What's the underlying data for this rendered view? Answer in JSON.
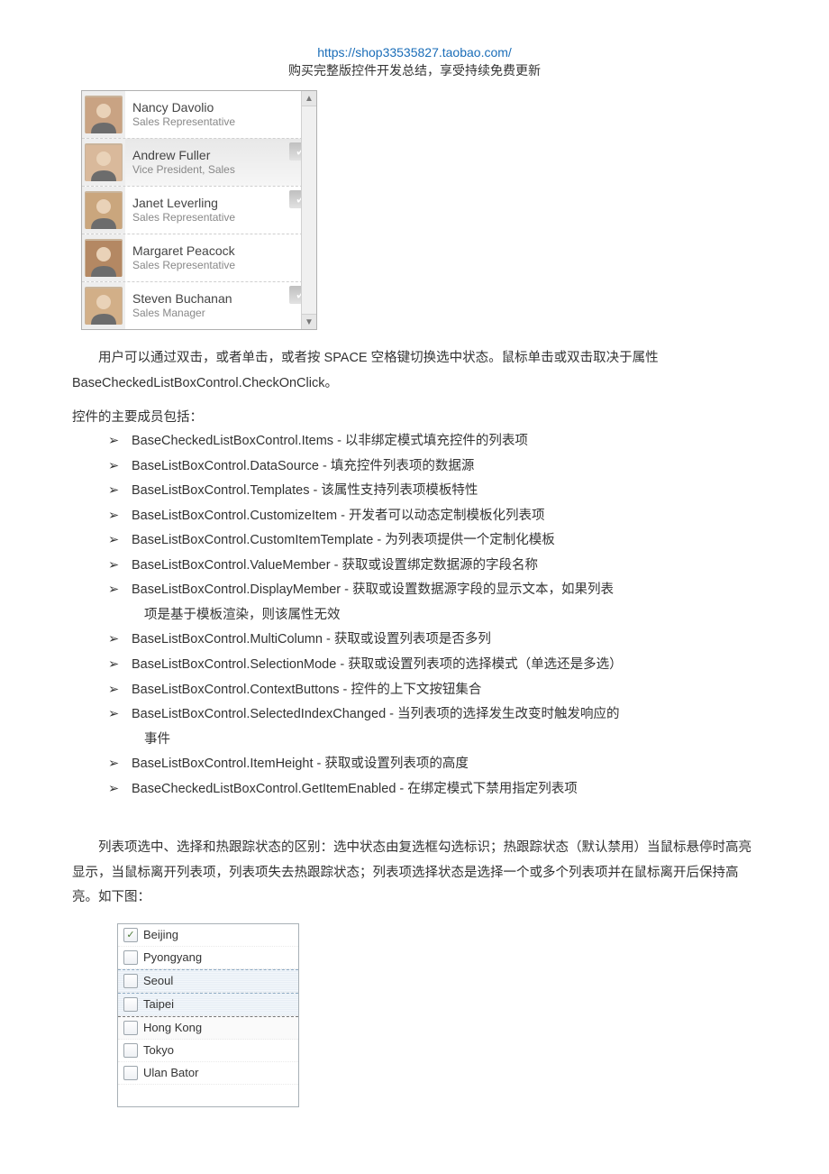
{
  "header": {
    "link": "https://shop33535827.taobao.com/",
    "subtitle": "购买完整版控件开发总结，享受持续免费更新"
  },
  "employees": [
    {
      "name": "Nancy Davolio",
      "title": "Sales Representative",
      "checked": false,
      "selected": false,
      "avatar_bg": "#c9a383"
    },
    {
      "name": "Andrew Fuller",
      "title": "Vice President, Sales",
      "checked": true,
      "selected": true,
      "avatar_bg": "#d9b99b"
    },
    {
      "name": "Janet Leverling",
      "title": "Sales Representative",
      "checked": true,
      "selected": false,
      "avatar_bg": "#caa67d"
    },
    {
      "name": "Margaret Peacock",
      "title": "Sales Representative",
      "checked": false,
      "selected": false,
      "avatar_bg": "#b48863"
    },
    {
      "name": "Steven Buchanan",
      "title": "Sales Manager",
      "checked": true,
      "selected": false,
      "avatar_bg": "#d2af88"
    }
  ],
  "paragraph1": "用户可以通过双击，或者单击，或者按 SPACE 空格键切换选中状态。鼠标单击或双击取决于属性 BaseCheckedListBoxControl.CheckOnClick。",
  "section_title": "控件的主要成员包括：",
  "bullets": [
    "BaseCheckedListBoxControl.Items - 以非绑定模式填充控件的列表项",
    "BaseListBoxControl.DataSource   - 填充控件列表项的数据源",
    "BaseListBoxControl.Templates - 该属性支持列表项模板特性",
    "BaseListBoxControl.CustomizeItem - 开发者可以动态定制模板化列表项",
    "BaseListBoxControl.CustomItemTemplate - 为列表项提供一个定制化模板",
    "BaseListBoxControl.ValueMember - 获取或设置绑定数据源的字段名称",
    "BaseListBoxControl.DisplayMember - 获取或设置数据源字段的显示文本，如果列表项是基于模板渲染，则该属性无效",
    "BaseListBoxControl.MultiColumn - 获取或设置列表项是否多列",
    "BaseListBoxControl.SelectionMode - 获取或设置列表项的选择模式（单选还是多选）",
    "BaseListBoxControl.ContextButtons - 控件的上下文按钮集合",
    "BaseListBoxControl.SelectedIndexChanged - 当列表项的选择发生改变时触发响应的事件",
    "BaseListBoxControl.ItemHeight - 获取或设置列表项的高度",
    "BaseCheckedListBoxControl.GetItemEnabled - 在绑定模式下禁用指定列表项"
  ],
  "bullet_notes": {
    "6": "项是基于模板渲染，则该属性无效",
    "10": "事件"
  },
  "bullet_main_override": {
    "6": "BaseListBoxControl.DisplayMember - 获取或设置数据源字段的显示文本，如果列表",
    "10": "BaseListBoxControl.SelectedIndexChanged - 当列表项的选择发生改变时触发响应的"
  },
  "paragraph2": "列表项选中、选择和热跟踪状态的区别：选中状态由复选框勾选标识；热跟踪状态（默认禁用）当鼠标悬停时高亮显示，当鼠标离开列表项，列表项失去热跟踪状态；列表项选择状态是选择一个或多个列表项并在鼠标离开后保持高亮。如下图：",
  "cities": [
    {
      "label": "Beijing",
      "checked": true,
      "state": "normal"
    },
    {
      "label": "Pyongyang",
      "checked": false,
      "state": "normal"
    },
    {
      "label": "Seoul",
      "checked": false,
      "state": "selected"
    },
    {
      "label": "Taipei",
      "checked": false,
      "state": "selected"
    },
    {
      "label": "Hong Kong",
      "checked": false,
      "state": "focused"
    },
    {
      "label": "Tokyo",
      "checked": false,
      "state": "normal"
    },
    {
      "label": "Ulan Bator",
      "checked": false,
      "state": "normal"
    }
  ]
}
